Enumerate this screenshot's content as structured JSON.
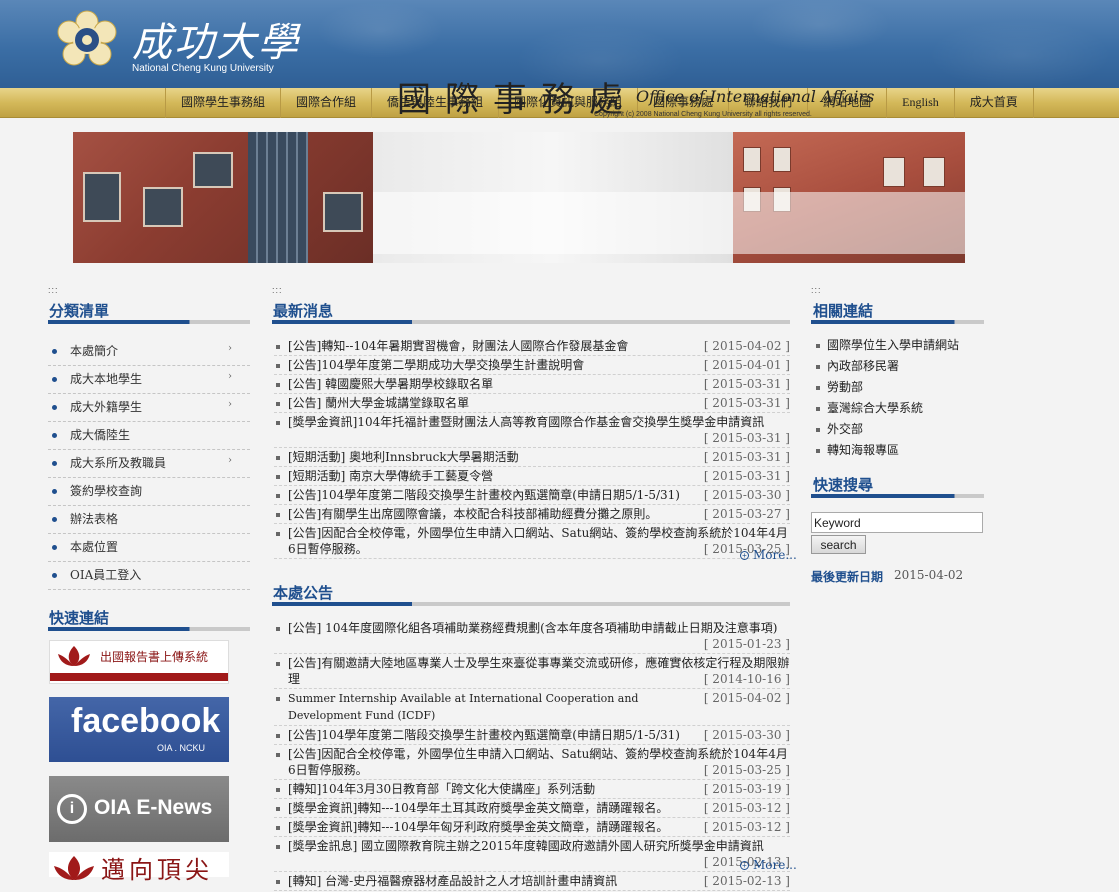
{
  "header": {
    "title": "成功大學",
    "subtitle": "National Cheng Kung University"
  },
  "nav": {
    "items": [
      "國際學生事務組",
      "國際合作組",
      "僑生與陸生事務組",
      "國際化資訊與服務組",
      "國際事務處",
      "聯絡我們",
      "網站地圖",
      "English",
      "成大首頁"
    ]
  },
  "banner": {
    "title_cn": "國際事務處",
    "title_en": "Office of International Affairs",
    "copyright": "Copyright (c) 2008 National Cheng Kung University all rights reserved."
  },
  "sidebar_left": {
    "dots": ":::",
    "category_title": "分類清單",
    "categories": [
      {
        "label": "本處簡介",
        "has_sub": true
      },
      {
        "label": "成大本地學生",
        "has_sub": true
      },
      {
        "label": "成大外籍學生",
        "has_sub": true
      },
      {
        "label": "成大僑陸生",
        "has_sub": false
      },
      {
        "label": "成大系所及教職員",
        "has_sub": true
      },
      {
        "label": "簽約學校查詢",
        "has_sub": false
      },
      {
        "label": "辦法表格",
        "has_sub": false
      },
      {
        "label": "本處位置",
        "has_sub": false
      },
      {
        "label": "OIA員工登入",
        "has_sub": false
      }
    ],
    "sub_arrow": "›",
    "quick_title": "快速連結",
    "quick_links": {
      "report": "出國報告書上傳系統",
      "facebook": "facebook",
      "facebook_sub": "OIA . NCKU",
      "enews_icon": "i",
      "enews": "OIA E-News",
      "top": "邁向頂尖"
    }
  },
  "center": {
    "dots": ":::",
    "news_title": "最新消息",
    "news": [
      {
        "text": "[公告]轉知--104年暑期實習機會，財團法人國際合作發展基金會",
        "date": "[ 2015-04-02 ]",
        "wrap": false
      },
      {
        "text": "[公告]104學年度第二學期成功大學交換學生計畫說明會",
        "date": "[ 2015-04-01 ]",
        "wrap": false
      },
      {
        "text": "[公告] 韓國慶熙大學暑期學校錄取名單",
        "date": "[ 2015-03-31 ]",
        "wrap": false
      },
      {
        "text": "[公告] 蘭州大學金城講堂錄取名單",
        "date": "[ 2015-03-31 ]",
        "wrap": false
      },
      {
        "text": "[獎學金資訊]104年托福計畫暨財團法人高等教育國際合作基金會交換學生獎學金申請資訊",
        "date": "[ 2015-03-31 ]",
        "wrap": true
      },
      {
        "text": "[短期活動] 奧地利Innsbruck大學暑期活動",
        "date": "[ 2015-03-31 ]",
        "wrap": false
      },
      {
        "text": "[短期活動] 南京大學傳統手工藝夏令營",
        "date": "[ 2015-03-31 ]",
        "wrap": false
      },
      {
        "text": "[公告]104學年度第二階段交換學生計畫校內甄選簡章(申請日期5/1-5/31)",
        "date": "[ 2015-03-30 ]",
        "wrap": false
      },
      {
        "text": "[公告]有關學生出席國際會議，本校配合科技部補助經費分攤之原則。",
        "date": "[ 2015-03-27 ]",
        "wrap": false
      },
      {
        "text": "[公告]因配合全校停電，外國學位生申請入口網站、Satu網站、簽約學校查詢系統於104年4月6日暫停服務。",
        "date": "[ 2015-03-25 ]",
        "wrap": false
      }
    ],
    "more_icon": "+",
    "more_label": "More...",
    "announce_title": "本處公告",
    "announcements": [
      {
        "text": "[公告] 104年度國際化組各項補助業務經費規劃(含本年度各項補助申請截止日期及注意事項)",
        "date": "[ 2015-01-23 ]",
        "wrap": true
      },
      {
        "text": "[公告]有關邀請大陸地區專業人士及學生來臺從事專業交流或研修，應確實依核定行程及期限辦理",
        "date": "[ 2014-10-16 ]",
        "wrap": false
      },
      {
        "text": "Summer Internship Available at International Cooperation and Development Fund (ICDF)",
        "date": "[ 2015-04-02 ]",
        "wrap": false
      },
      {
        "text": "[公告]104學年度第二階段交換學生計畫校內甄選簡章(申請日期5/1-5/31)",
        "date": "[ 2015-03-30 ]",
        "wrap": false
      },
      {
        "text": "[公告]因配合全校停電，外國學位生申請入口網站、Satu網站、簽約學校查詢系統於104年4月6日暫停服務。",
        "date": "[ 2015-03-25 ]",
        "wrap": false
      },
      {
        "text": "[轉知]104年3月30日教育部「跨文化大使講座」系列活動",
        "date": "[ 2015-03-19 ]",
        "wrap": false
      },
      {
        "text": "[獎學金資訊]轉知---104學年土耳其政府獎學金英文簡章，請踴躍報名。",
        "date": "[ 2015-03-12 ]",
        "wrap": false
      },
      {
        "text": "[獎學金資訊]轉知---104學年匈牙利政府獎學金英文簡章，請踴躍報名。",
        "date": "[ 2015-03-12 ]",
        "wrap": false
      },
      {
        "text": "[獎學金訊息] 國立國際教育院主辦之2015年度韓國政府邀請外國人研究所獎學金申請資訊",
        "date": "[ 2015-02-13 ]",
        "wrap": true
      },
      {
        "text": "[轉知] 台灣-史丹福醫療器材產品設計之人才培訓計畫申請資訊",
        "date": "[ 2015-02-13 ]",
        "wrap": false
      }
    ]
  },
  "sidebar_right": {
    "dots": ":::",
    "links_title": "相關連結",
    "links": [
      "國際學位生入學申請網站",
      "內政部移民署",
      "勞動部",
      "臺灣綜合大學系統",
      "外交部",
      "轉知海報專區"
    ],
    "search_title": "快速搜尋",
    "search_value": "Keyword",
    "search_button": "search",
    "updated_label": "最後更新日期",
    "updated_value": "2015-04-02"
  },
  "colors": {
    "accent": "#1f4f8e",
    "header_blue": "#3b6ea5",
    "nav_gold": "#d4b95a"
  }
}
